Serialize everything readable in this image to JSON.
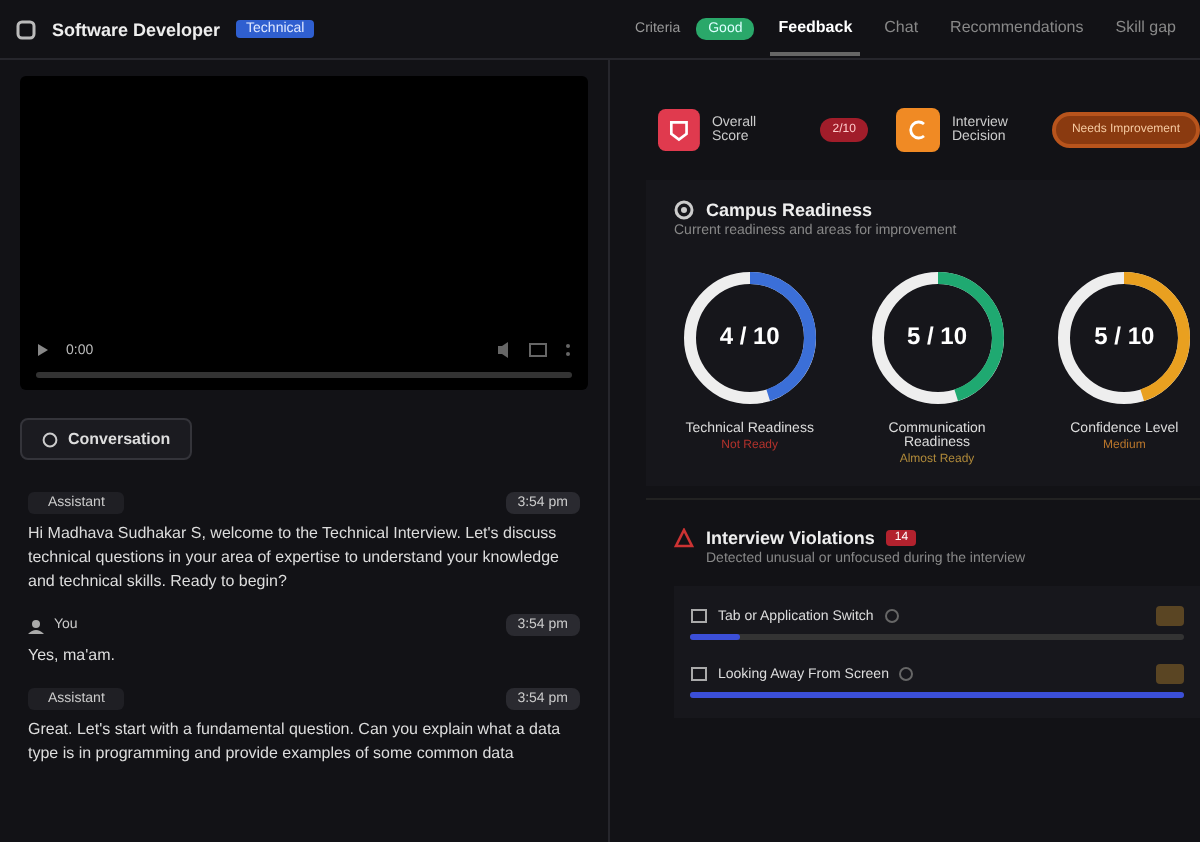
{
  "header": {
    "title": "Software Developer",
    "badge": "Technical",
    "criteria": "Criteria",
    "status": "Good"
  },
  "tabs": [
    {
      "label": "Feedback",
      "selected": true
    },
    {
      "label": "Chat",
      "selected": false
    },
    {
      "label": "Recommendations",
      "selected": false
    },
    {
      "label": "Skill gap",
      "selected": false
    }
  ],
  "video": {
    "time": "0:00"
  },
  "conversation": {
    "button": "Conversation",
    "messages": [
      {
        "kind": "assistant",
        "sender": "Assistant",
        "time": "3:54 pm",
        "text": "Hi Madhava Sudhakar S, welcome to the Technical Interview. Let's discuss technical questions in your area of expertise to understand your knowledge and technical skills. Ready to begin?"
      },
      {
        "kind": "user",
        "sender": "You",
        "time": "3:54 pm",
        "text": "Yes, ma'am."
      },
      {
        "kind": "assistant",
        "sender": "Assistant",
        "time": "3:54 pm",
        "text": "Great. Let's start with a fundamental question. Can you explain what a data type is in programming and provide examples of some common data"
      }
    ]
  },
  "summary": {
    "score_label": "Overall Score",
    "score": "2/10",
    "decision_label": "Interview Decision",
    "decision": "Needs Improvement"
  },
  "readiness": {
    "title": "Campus Readiness",
    "subtitle": "Current readiness and areas for improvement",
    "metrics": [
      {
        "value": "4 / 10",
        "label": "Technical Readiness",
        "status": {
          "text": "Not Ready",
          "color": "#b3322c"
        },
        "color": "#3b6fd8"
      },
      {
        "value": "5 / 10",
        "label": "Communication Readiness",
        "status": {
          "text": "Almost Ready",
          "color": "#b08a3a"
        },
        "color": "#1fa971"
      },
      {
        "value": "5 / 10",
        "label": "Confidence Level",
        "status": {
          "text": "Medium",
          "color": "#b8752b"
        },
        "color": "#e9a020"
      }
    ]
  },
  "violations": {
    "title": "Interview Violations",
    "count": "14",
    "subtitle": "Detected unusual or unfocused during the interview",
    "items": [
      {
        "label": "Tab or Application Switch",
        "level": 0.1
      },
      {
        "label": "Looking Away From Screen",
        "level": 1.0
      }
    ]
  }
}
